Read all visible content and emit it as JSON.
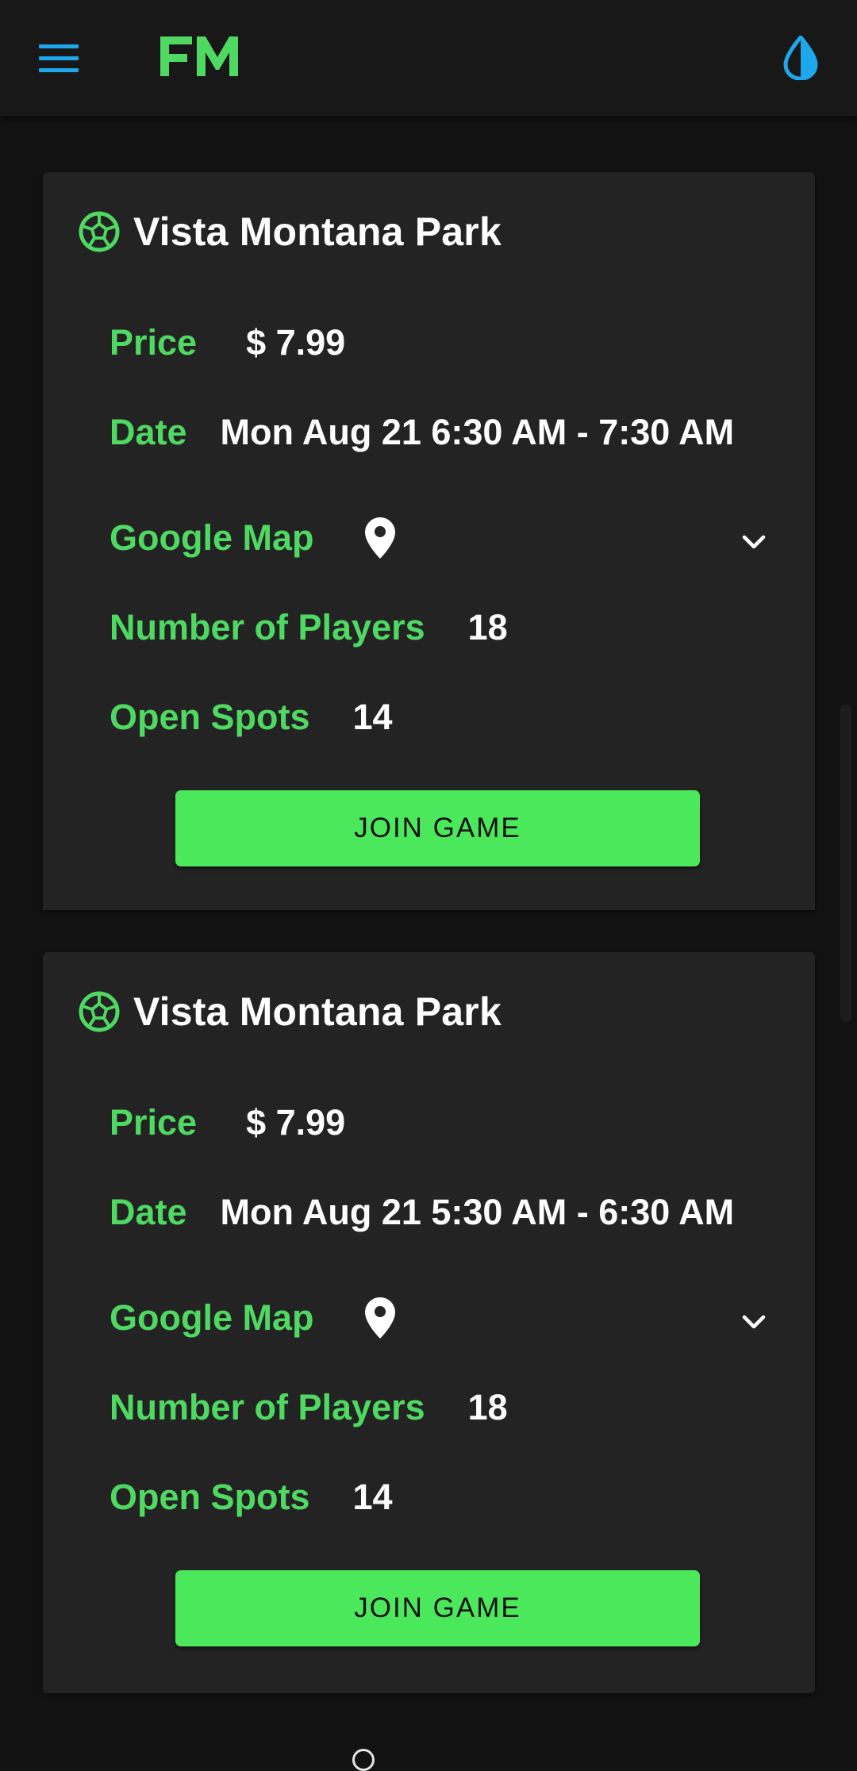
{
  "app": {
    "logo_text": "FM",
    "brand_color": "#4fd862",
    "accent_color": "#1ea7ea",
    "menu_icon": "hamburger-menu-icon",
    "theme_icon": "water-drop-icon"
  },
  "games": [
    {
      "title": "Vista Montana Park",
      "price_label": "Price",
      "price_value": "$ 7.99",
      "date_label": "Date",
      "date_value": "Mon Aug 21 6:30 AM - 7:30 AM",
      "map_label": "Google Map",
      "players_label": "Number of Players",
      "players_value": "18",
      "spots_label": "Open Spots",
      "spots_value": "14",
      "join_label": "JOIN GAME"
    },
    {
      "title": "Vista Montana Park",
      "price_label": "Price",
      "price_value": "$ 7.99",
      "date_label": "Date",
      "date_value": "Mon Aug 21 5:30 AM - 6:30 AM",
      "map_label": "Google Map",
      "players_label": "Number of Players",
      "players_value": "18",
      "spots_label": "Open Spots",
      "spots_value": "14",
      "join_label": "JOIN GAME"
    }
  ]
}
